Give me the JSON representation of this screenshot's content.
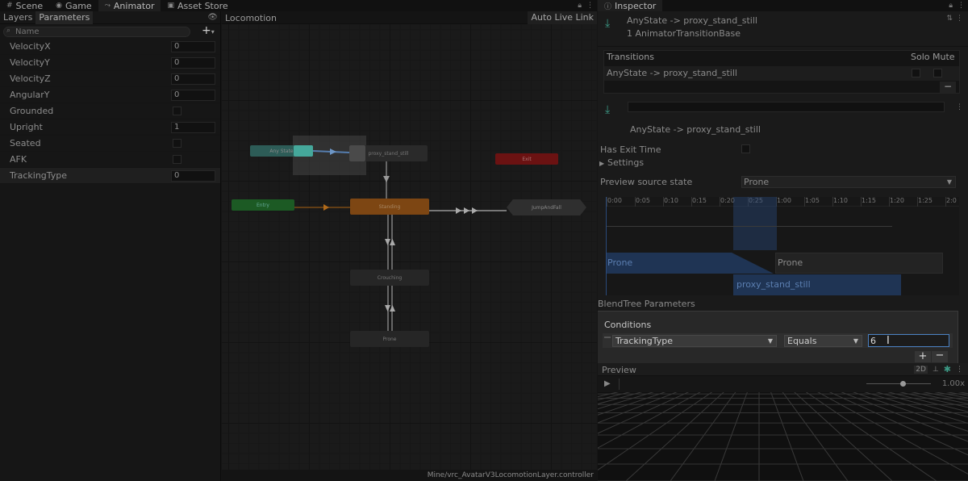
{
  "left_tabs": [
    {
      "label": "Scene",
      "icon": "grid-icon"
    },
    {
      "label": "Game",
      "icon": "gamepad-icon"
    },
    {
      "label": "Animator",
      "icon": "animator-icon"
    },
    {
      "label": "Asset Store",
      "icon": "bag-icon"
    }
  ],
  "inspector_tab": {
    "label": "Inspector",
    "icon": "info-icon"
  },
  "parameters_panel": {
    "tabs": [
      "Layers",
      "Parameters"
    ],
    "search_placeholder": "Name",
    "add_label": "+",
    "params": [
      {
        "name": "VelocityX",
        "type": "float",
        "value": "0"
      },
      {
        "name": "VelocityY",
        "type": "float",
        "value": "0"
      },
      {
        "name": "VelocityZ",
        "type": "float",
        "value": "0"
      },
      {
        "name": "AngularY",
        "type": "float",
        "value": "0"
      },
      {
        "name": "Grounded",
        "type": "bool",
        "value": false
      },
      {
        "name": "Upright",
        "type": "float",
        "value": "1"
      },
      {
        "name": "Seated",
        "type": "bool",
        "value": false
      },
      {
        "name": "AFK",
        "type": "bool",
        "value": false
      },
      {
        "name": "TrackingType",
        "type": "int",
        "value": "0"
      }
    ]
  },
  "graph": {
    "breadcrumb": "Locomotion",
    "auto_live_link": "Auto Live Link",
    "footer_path": "Mine/vrc_AvatarV3LocomotionLayer.controller",
    "states": {
      "any_state": "Any State",
      "proxy": "proxy_stand_still",
      "exit": "Exit",
      "entry": "Entry",
      "standing": "Standing",
      "jump": "JumpAndFall",
      "crouching": "Crouching",
      "prone": "Prone"
    }
  },
  "inspector": {
    "title": "AnyState -> proxy_stand_still",
    "subtitle": "1 AnimatorTransitionBase",
    "transitions": {
      "header": "Transitions",
      "solo": "Solo",
      "mute": "Mute",
      "row": "AnyState -> proxy_stand_still",
      "minus": "−"
    },
    "transition_name": "AnyState -> proxy_stand_still",
    "has_exit_time": "Has Exit Time",
    "settings": "Settings",
    "preview_source_state": {
      "label": "Preview source state",
      "value": "Prone"
    },
    "timeline": {
      "ticks": [
        "0:00",
        "0:05",
        "0:10",
        "0:15",
        "0:20",
        "0:25",
        "1:00",
        "1:05",
        "1:10",
        "1:15",
        "1:20",
        "1:25",
        "2:0"
      ],
      "clip_source_1": "Prone",
      "clip_source_2": "Prone",
      "clip_dest": "proxy_stand_still"
    },
    "blendtree_params": "BlendTree Parameters",
    "conditions": {
      "title": "Conditions",
      "parameter": "TrackingType",
      "mode": "Equals",
      "value": "6",
      "plus": "+",
      "minus": "−"
    },
    "preview": {
      "label": "Preview",
      "mode_2d": "2D",
      "speed": "1.00x"
    }
  },
  "colors": {
    "any_state": "#2d5c57",
    "entry": "#1c5a24",
    "exit": "#6b1212",
    "default_state": "#7d4613",
    "selection_blue": "#4a80c0"
  }
}
